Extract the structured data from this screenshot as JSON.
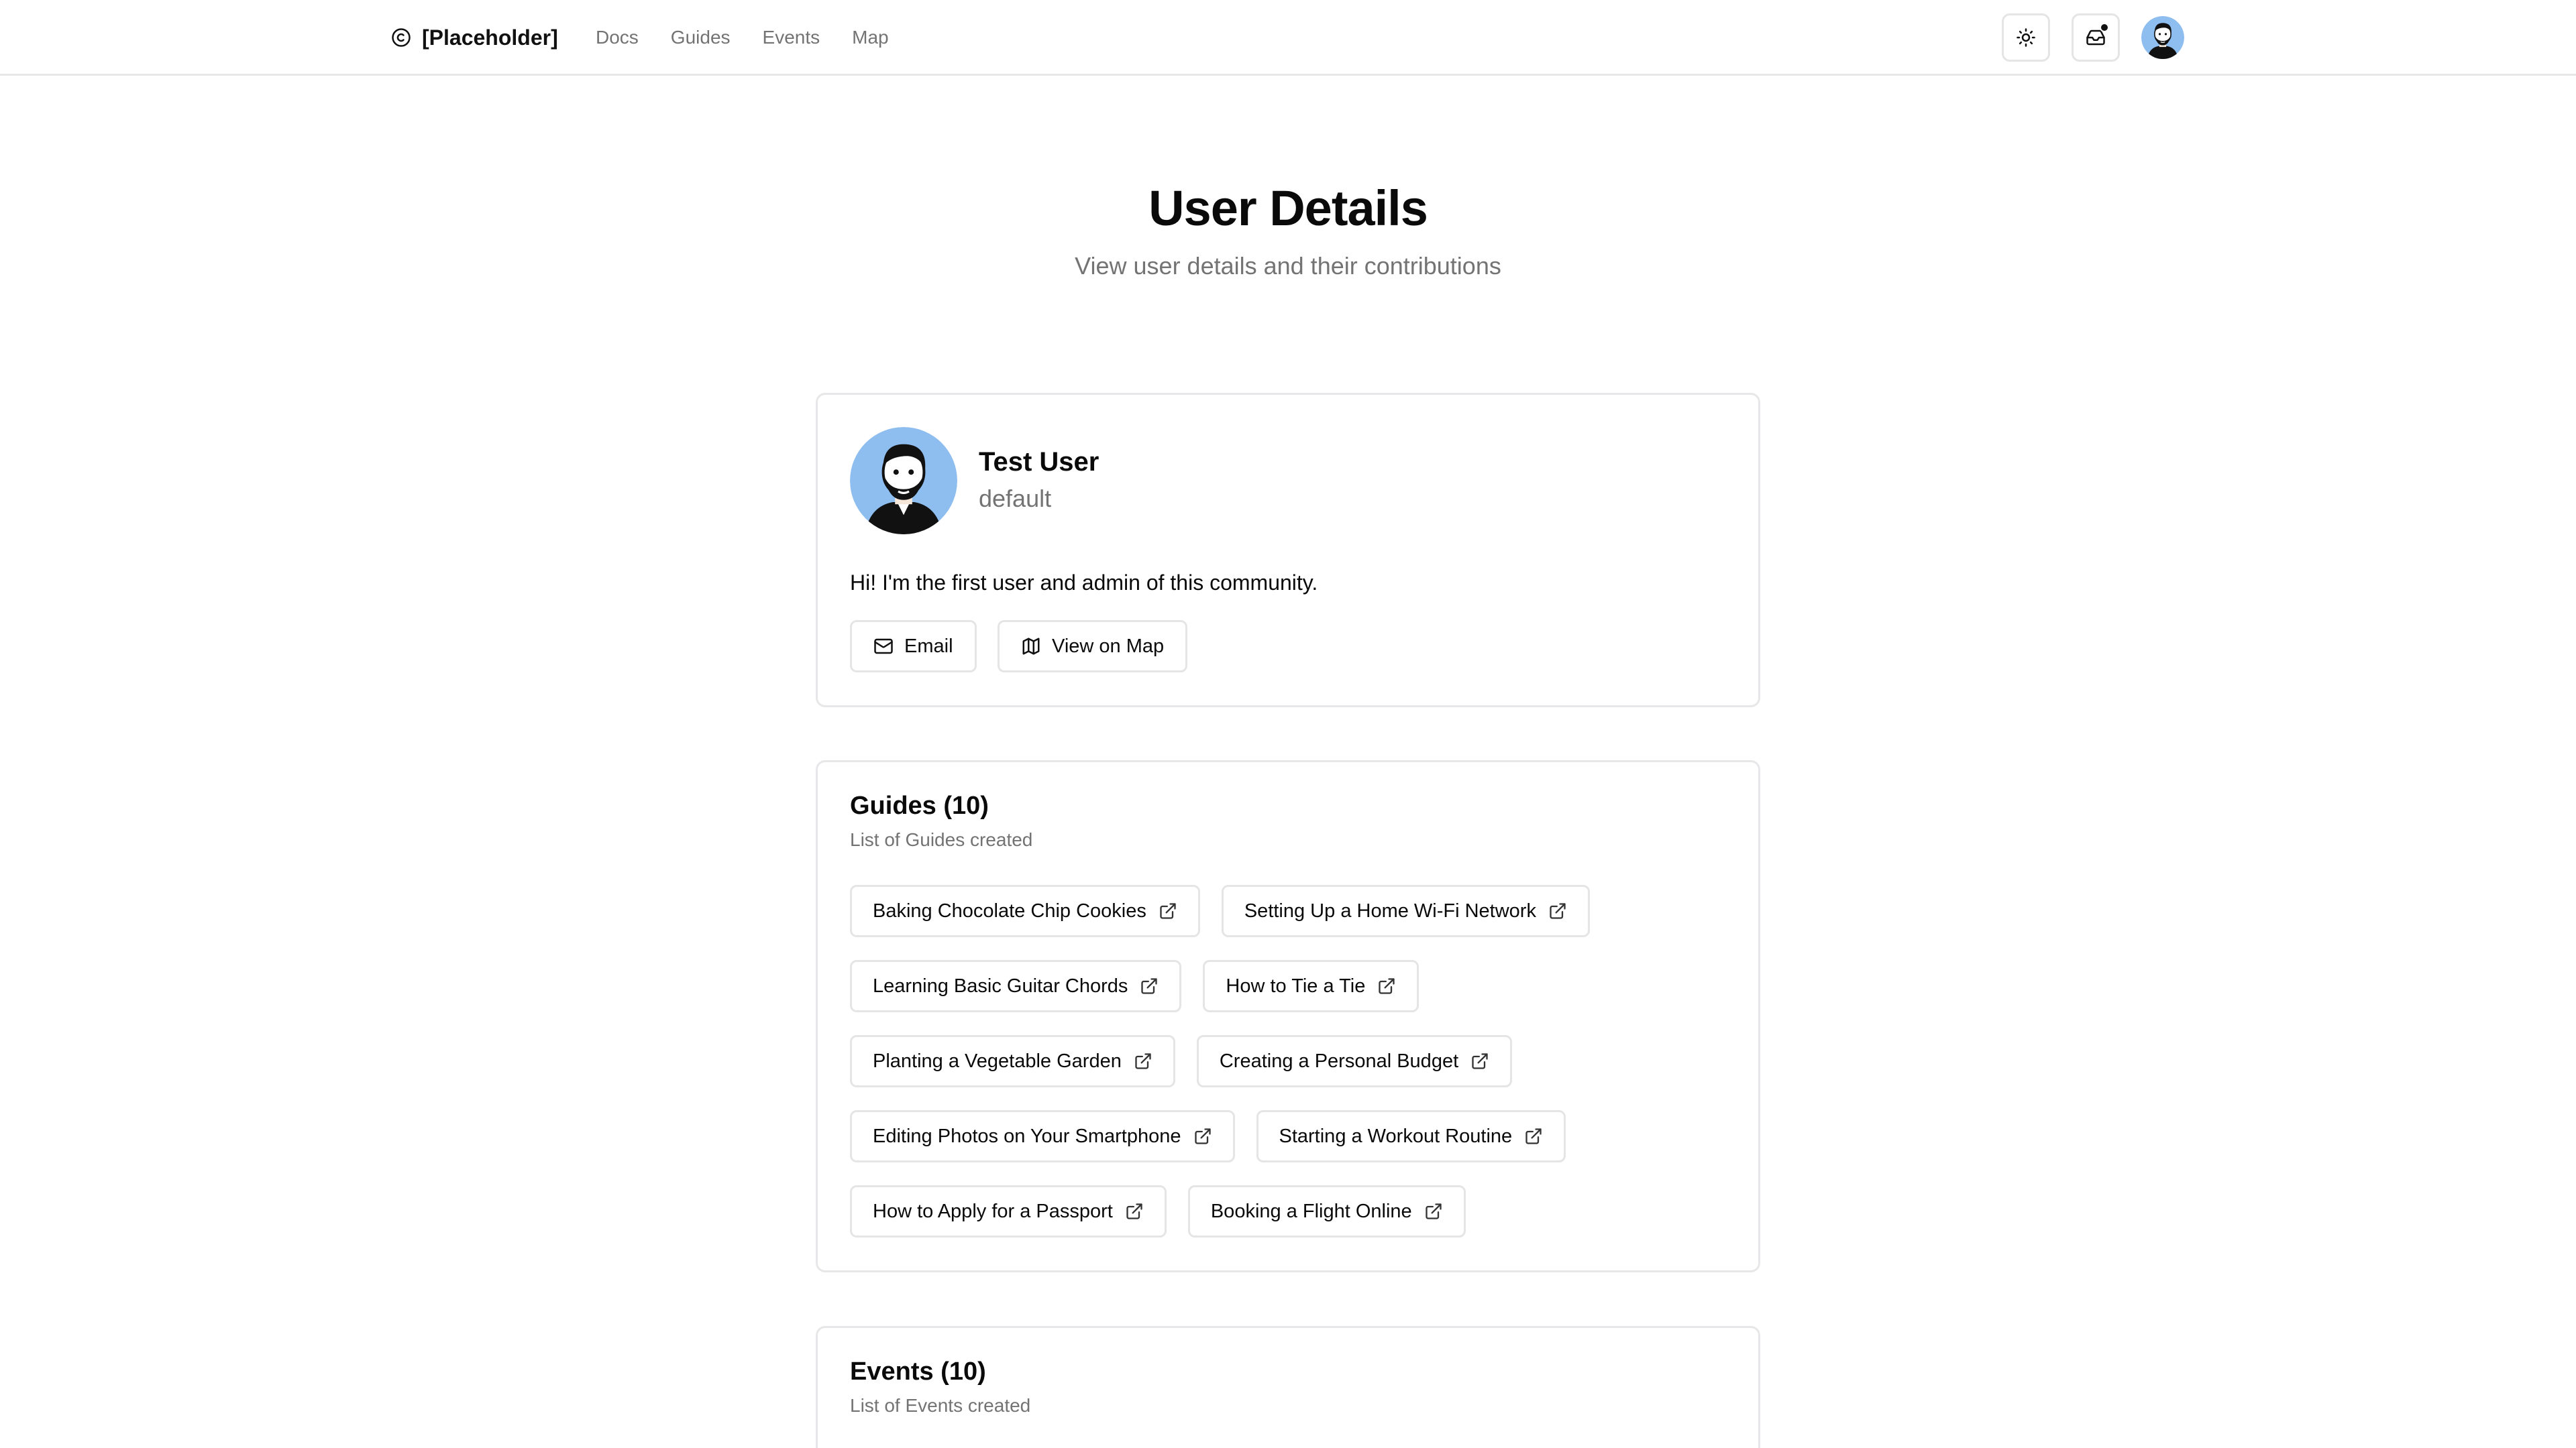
{
  "header": {
    "brand": "[Placeholder]",
    "brand_icon": "copyright-icon",
    "nav": [
      "Docs",
      "Guides",
      "Events",
      "Map"
    ],
    "icons": [
      "sun-icon",
      "inbox-icon",
      "avatar"
    ]
  },
  "page": {
    "title": "User Details",
    "subtitle": "View user details and their contributions"
  },
  "profile": {
    "name": "Test User",
    "role": "default",
    "bio": "Hi! I'm the first user and admin of this community.",
    "email_label": "Email",
    "map_label": "View on Map"
  },
  "guides": {
    "title": "Guides (10)",
    "subtitle": "List of Guides created",
    "items": [
      "Baking Chocolate Chip Cookies",
      "Setting Up a Home Wi-Fi Network",
      "Learning Basic Guitar Chords",
      "How to Tie a Tie",
      "Planting a Vegetable Garden",
      "Creating a Personal Budget",
      "Editing Photos on Your Smartphone",
      "Starting a Workout Routine",
      "How to Apply for a Passport",
      "Booking a Flight Online"
    ]
  },
  "events": {
    "title": "Events (10)",
    "subtitle": "List of Events created"
  },
  "colors": {
    "avatar_bg": "#8ebdf0",
    "border": "#e7e7e9",
    "muted_text": "#737373"
  }
}
